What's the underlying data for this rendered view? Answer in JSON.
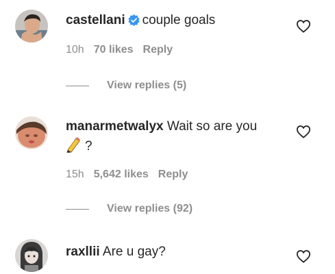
{
  "comments": [
    {
      "username": "castellani",
      "verified": true,
      "text": "couple goals",
      "time": "10h",
      "likes": "70 likes",
      "reply": "Reply",
      "view_replies": "View replies (5)",
      "avatar_icon": "profile-photo"
    },
    {
      "username": "manarmetwalyx",
      "verified": false,
      "text": "Wait so are you",
      "text_line2": "?",
      "emoji_icon": "pencil-emoji",
      "time": "15h",
      "likes": "5,642 likes",
      "reply": "Reply",
      "view_replies": "View replies (92)",
      "avatar_icon": "profile-photo"
    },
    {
      "username": "raxllii",
      "verified": false,
      "text": "Are u gay?",
      "avatar_icon": "profile-photo"
    }
  ],
  "colors": {
    "text": "#262626",
    "meta": "#8e8e8e",
    "verified_badge": "#3897f0"
  }
}
